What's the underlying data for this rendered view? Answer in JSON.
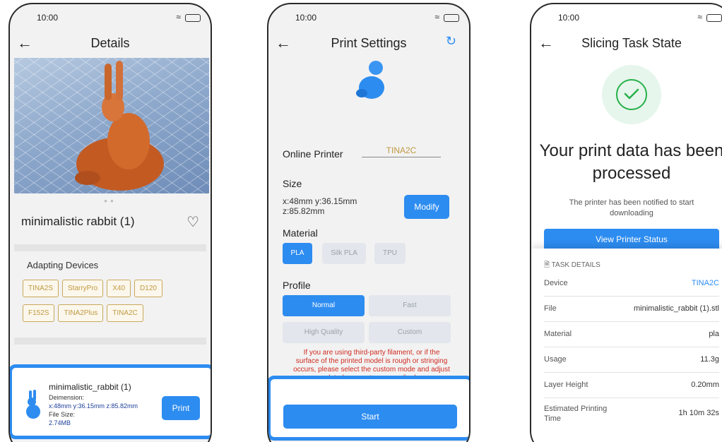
{
  "status": {
    "time": "10:00"
  },
  "details": {
    "title": "Details",
    "model_name": "minimalistic rabbit (1)",
    "adapting_title": "Adapting Devices",
    "devices": [
      "TINA2S",
      "StarryPro",
      "X40",
      "D120",
      "F152S",
      "TINA2Plus",
      "TINA2C"
    ],
    "bottom": {
      "name": "minimalistic_rabbit (1)",
      "dimension_label": "Deimension:",
      "dimension_value": "x:48mm y:36.15mm z:85.82mm",
      "size_label": "File Size:",
      "size_value": "2.74MB",
      "print_label": "Print"
    }
  },
  "settings": {
    "title": "Print Settings",
    "online_printer_label": "Online Printer",
    "online_printer_value": "TINA2C",
    "size_label": "Size",
    "size_line1": "x:48mm y:36.15mm",
    "size_line2": "z:85.82mm",
    "modify_label": "Modify",
    "material_label": "Material",
    "materials": [
      "PLA",
      "Silk PLA",
      "TPU"
    ],
    "profile_label": "Profile",
    "profiles": [
      "Normal",
      "Fast",
      "High Quality",
      "Custom"
    ],
    "warning": "If you are using third-party filament, or if the surface of the printed model is rough or stringing occurs, please select the custom mode and adjust related parameters accordingly.",
    "start_label": "Start"
  },
  "task": {
    "title": "Slicing Task State",
    "headline": "Your print data has been processed",
    "subline": "The printer has been notified to start downloading",
    "view_label": "View Printer Status",
    "details_label": "TASK DETAILS",
    "rows": [
      {
        "k": "Device",
        "v": "TINA2C"
      },
      {
        "k": "File",
        "v": "minimalistic_rabbit (1).stl"
      },
      {
        "k": "Material",
        "v": "pla"
      },
      {
        "k": "Usage",
        "v": "11.3g"
      },
      {
        "k": "Layer Height",
        "v": "0.20mm"
      },
      {
        "k": "Estimated Printing Time",
        "v": "1h 10m 32s"
      }
    ]
  },
  "colors": {
    "accent": "#2d8cf0",
    "chip": "#c09a42",
    "success": "#27b04a",
    "warning": "#d02b20"
  },
  "icons": [
    "back-arrow-icon",
    "wifi-icon",
    "battery-icon",
    "heart-icon",
    "refresh-icon",
    "check-icon",
    "document-icon",
    "rabbit-icon"
  ]
}
